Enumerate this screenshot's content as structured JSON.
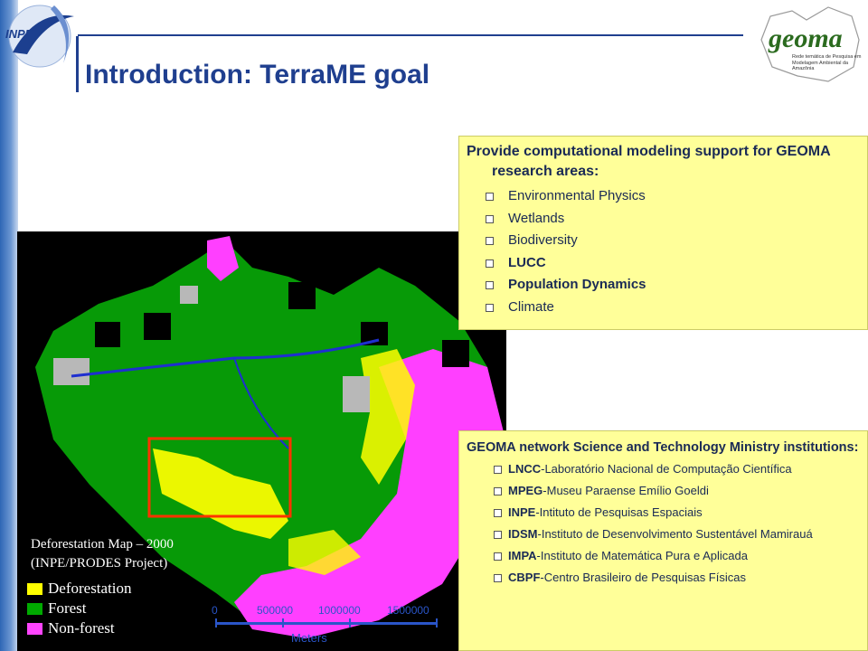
{
  "header": {
    "title": "Introduction: TerraME goal",
    "logo_left_text": "INPE",
    "logo_right_text": "geoma",
    "logo_right_subtitle": "Rede temática de Pesquisa em Modelagem Ambiental da Amazônia"
  },
  "box_top": {
    "heading": "Provide computational modeling support for GEOMA research areas:",
    "items": [
      {
        "label": "Environmental Physics",
        "bold": false
      },
      {
        "label": "Wetlands",
        "bold": false
      },
      {
        "label": "Biodiversity",
        "bold": false
      },
      {
        "label": "LUCC",
        "bold": true
      },
      {
        "label": "Population Dynamics",
        "bold": true
      },
      {
        "label": "Climate",
        "bold": false
      }
    ]
  },
  "box_bottom": {
    "heading": "GEOMA network Science and Technology Ministry institutions:",
    "items": [
      {
        "abbr": "LNCC",
        "name": "-Laboratório Nacional de Computação Científica"
      },
      {
        "abbr": "MPEG",
        "name": "-Museu Paraense Emílio Goeldi"
      },
      {
        "abbr": "INPE",
        "name": "-Intituto de Pesquisas Espaciais"
      },
      {
        "abbr": "IDSM",
        "name": "-Instituto de Desenvolvimento Sustentável Mamirauá"
      },
      {
        "abbr": "IMPA",
        "name": "-Instituto de Matemática Pura e Aplicada"
      },
      {
        "abbr": "CBPF",
        "name": "-Centro Brasileiro de Pesquisas Físicas"
      }
    ]
  },
  "map": {
    "caption_line1": "Deforestation Map – 2000",
    "caption_line2": "(INPE/PRODES Project)",
    "legend": [
      {
        "label": "Deforestation",
        "color": "#ffff00"
      },
      {
        "label": "Forest",
        "color": "#00aa00"
      },
      {
        "label": "Non-forest",
        "color": "#ff44ff"
      }
    ],
    "scale_ticks": [
      "0",
      "500000",
      "1000000",
      "1500000"
    ],
    "scale_unit": "Meters"
  },
  "colors": {
    "title": "#1f3f8f",
    "box_bg": "#ffff99",
    "forest": "#00aa00",
    "nonforest": "#ff44ff",
    "deforestation": "#ffff00",
    "highlight": "#ff3300"
  }
}
